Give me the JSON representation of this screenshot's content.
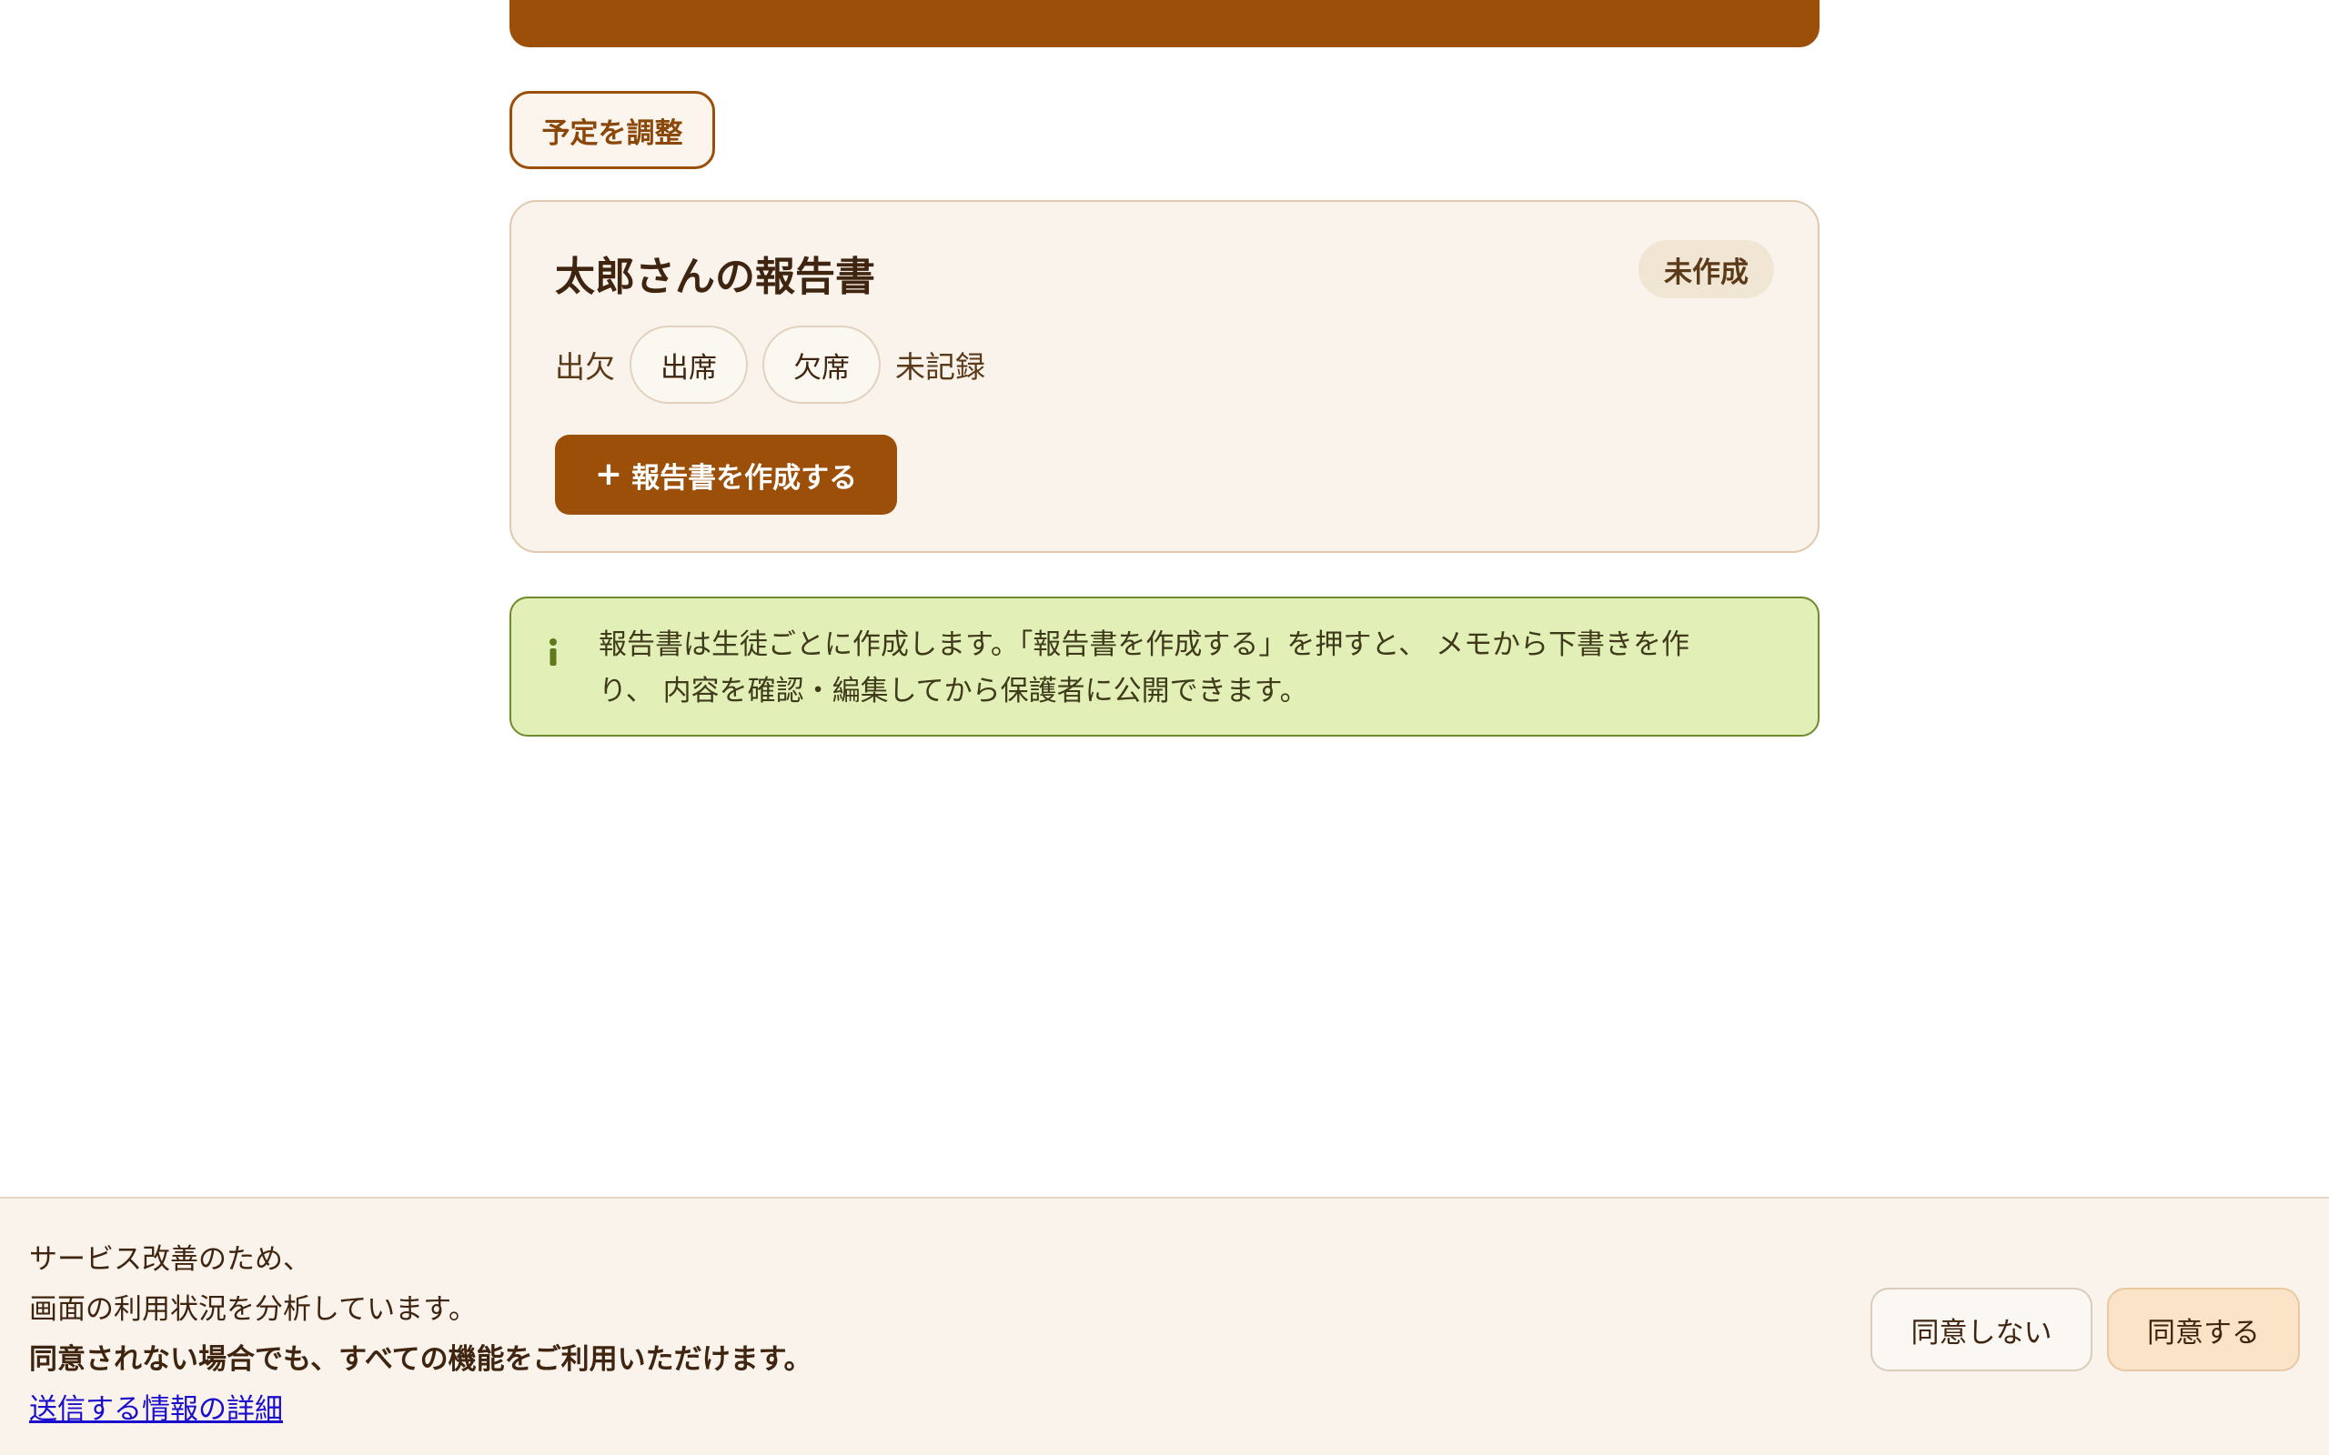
{
  "header": {
    "adjust_label": "予定を調整"
  },
  "report_card": {
    "title": "太郎さんの報告書",
    "status_badge": "未作成",
    "attendance": {
      "label": "出欠",
      "present_label": "出席",
      "absent_label": "欠席",
      "current_status": "未記録"
    },
    "create_button": {
      "icon": "plus-icon",
      "label": "報告書を作成する"
    }
  },
  "info_box": {
    "icon": "info-icon",
    "line1": "報告書は生徒ごとに作成します。「報告書を作成する」を押すと、 メモから下書きを作",
    "line2": "り、 内容を確認・編集してから保護者に公開できます。"
  },
  "consent": {
    "line1": "サービス改善のため、",
    "line2": "画面の利用状況を分析しています。",
    "line3": "同意されない場合でも、すべての機能をご利用いただけます。",
    "link": "送信する情報の詳細",
    "decline_label": "同意しない",
    "accept_label": "同意する"
  },
  "colors": {
    "accent": "#9b4f08",
    "card_background": "#f9f3ec",
    "info_background": "#e2f0b8",
    "info_border": "#6e8a2a",
    "link": "#1a0dcc"
  }
}
